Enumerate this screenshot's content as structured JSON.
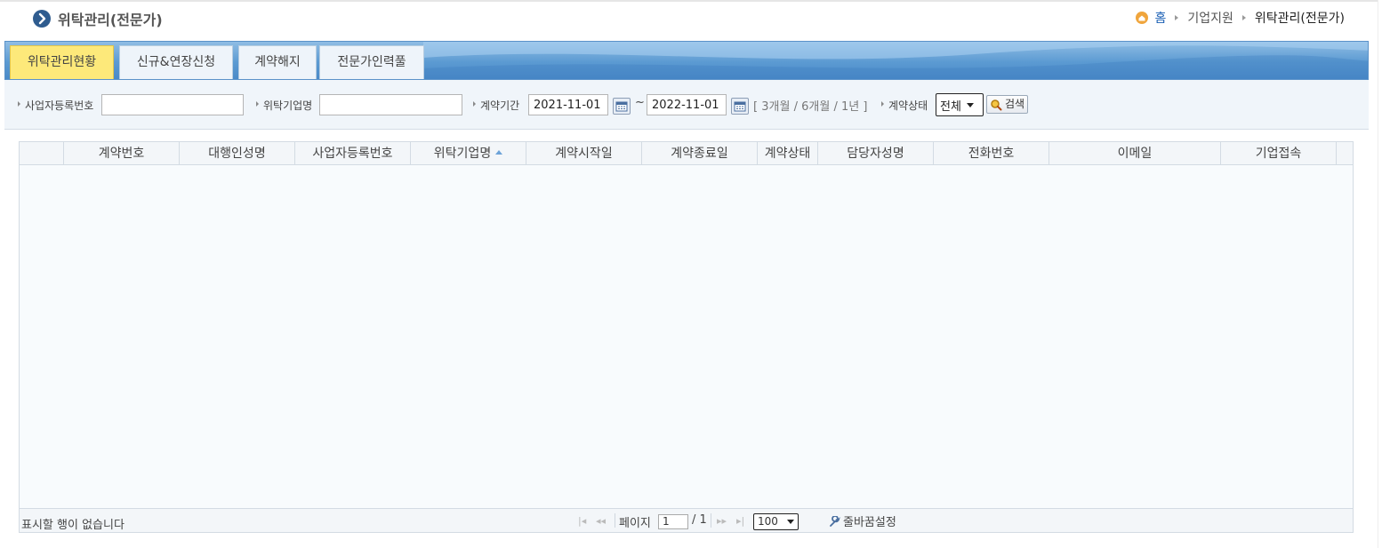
{
  "header": {
    "title": "위탁관리(전문가)",
    "breadcrumb": {
      "home": "홈",
      "section": "기업지원",
      "current": "위탁관리(전문가)"
    }
  },
  "tabs": [
    {
      "label": "위탁관리현황",
      "active": true
    },
    {
      "label": "신규&연장신청",
      "active": false
    },
    {
      "label": "계약해지",
      "active": false
    },
    {
      "label": "전문가인력풀",
      "active": false
    }
  ],
  "search": {
    "biz_no_label": "사업자등록번호",
    "biz_no_value": "",
    "company_label": "위탁기업명",
    "company_value": "",
    "period_label": "계약기간",
    "start_date": "2021-11-01",
    "tilde": "~",
    "end_date": "2022-11-01",
    "period_bracket_open": "[",
    "period_3m": "3개월",
    "period_sep1": "/",
    "period_6m": "6개월",
    "period_sep2": "/",
    "period_1y": "1년",
    "period_bracket_close": "]",
    "status_label": "계약상태",
    "status_value": "전체",
    "search_button": "검색"
  },
  "grid": {
    "columns": [
      "계약번호",
      "대행인성명",
      "사업자등록번호",
      "위탁기업명",
      "계약시작일",
      "계약종료일",
      "계약상태",
      "담당자성명",
      "전화번호",
      "이메일",
      "기업접속"
    ],
    "sorted_column": "위탁기업명",
    "rows": []
  },
  "pager": {
    "empty_message": "표시할 행이 없습니다",
    "page_label": "페이지",
    "page_value": "1",
    "total_pages": "/ 1",
    "page_size": "100",
    "wrap_setting": "줄바꿈설정"
  },
  "colors": {
    "tab_active": "#fde97a",
    "tabbar_blue": "#5b9ad2",
    "link_blue": "#1a5fb4",
    "title_icon": "#2f5c8f"
  }
}
